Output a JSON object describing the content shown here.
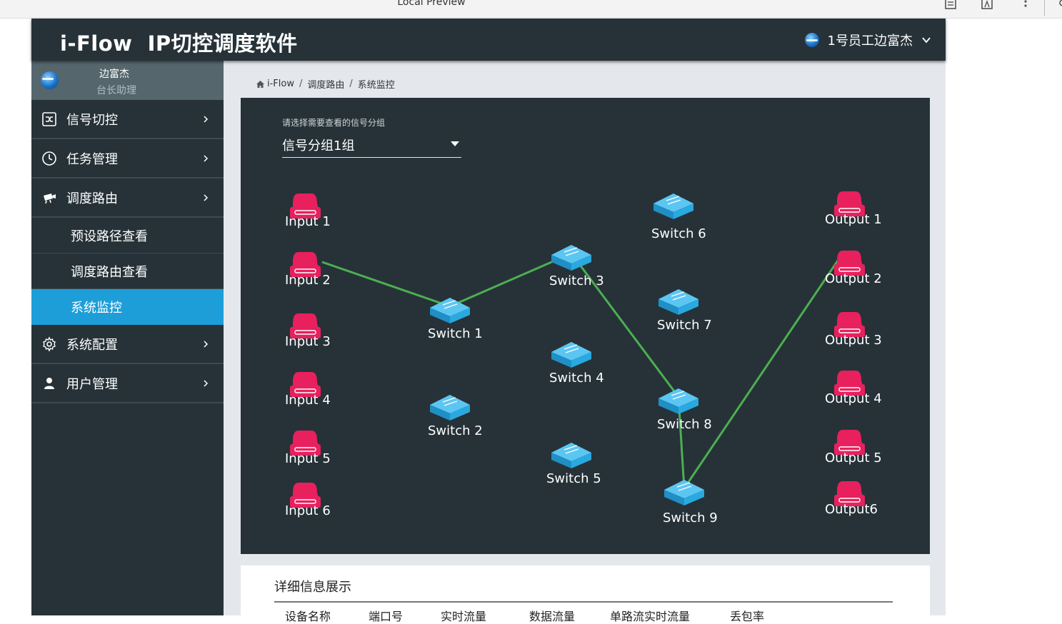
{
  "browser": {
    "title": "Local Preview"
  },
  "header": {
    "title": "i-Flow  IP切控调度软件",
    "user_label": "1号员工边富杰"
  },
  "profile": {
    "name": "边富杰",
    "role": "台长助理"
  },
  "sidebar": {
    "items": [
      {
        "label": "信号切控",
        "icon": "shuffle-icon"
      },
      {
        "label": "任务管理",
        "icon": "clock-icon"
      },
      {
        "label": "调度路由",
        "icon": "camera-icon"
      },
      {
        "label": "系统配置",
        "icon": "gear-icon"
      },
      {
        "label": "用户管理",
        "icon": "user-icon"
      }
    ],
    "sub_items": [
      {
        "label": "预设路径查看"
      },
      {
        "label": "调度路由查看"
      },
      {
        "label": "系统监控",
        "active": true
      }
    ]
  },
  "breadcrumb": [
    "i-Flow",
    "调度路由",
    "系统监控"
  ],
  "topology": {
    "select_label": "请选择需要查看的信号分组",
    "selected_group": "信号分组1组",
    "inputs": [
      "Input 1",
      "Input 2",
      "Input 3",
      "Input 4",
      "Input 5",
      "Input 6"
    ],
    "switches": [
      "Switch 1",
      "Switch 2",
      "Switch 3",
      "Switch 4",
      "Switch 5",
      "Switch 6",
      "Switch 7",
      "Switch 8",
      "Switch 9"
    ],
    "outputs": [
      "Output 1",
      "Output 2",
      "Output 3",
      "Output 4",
      "Output 5",
      "Output6"
    ],
    "active_path": [
      "Input 2",
      "Switch 1",
      "Switch 3",
      "Switch 8",
      "Switch 9",
      "Output 2"
    ],
    "colors": {
      "device": "#e8205e",
      "switch": "#29a9e0",
      "link": "#4caf50",
      "panel": "#263238",
      "accent": "#1d9ed9"
    }
  },
  "detail": {
    "title": "详细信息展示",
    "columns": [
      "设备名称",
      "端口号",
      "实时流量",
      "数据流量",
      "单路流实时流量",
      "丢包率"
    ]
  }
}
